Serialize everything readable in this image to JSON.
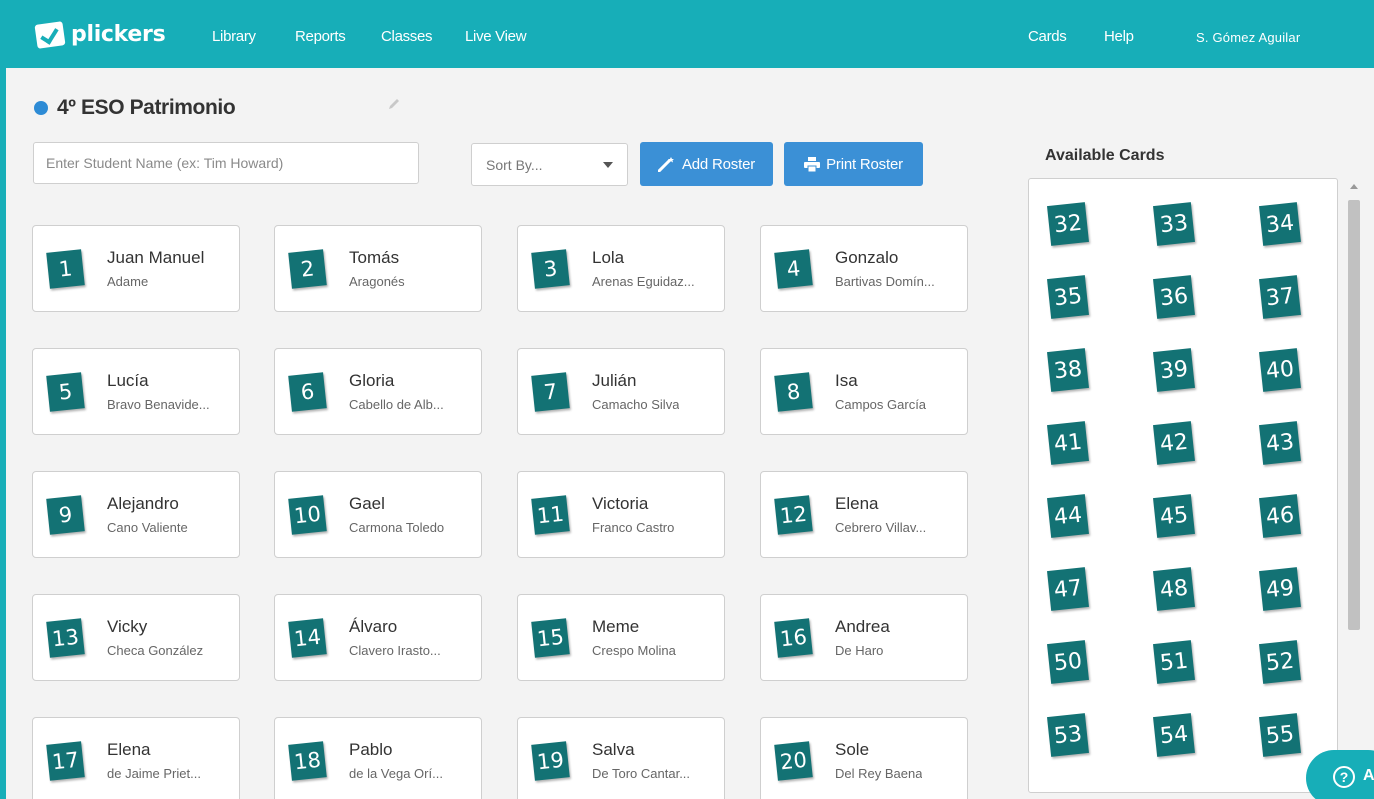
{
  "nav": {
    "logo_text": "plickers",
    "library": "Library",
    "reports": "Reports",
    "classes": "Classes",
    "live_view": "Live View",
    "cards": "Cards",
    "help": "Help",
    "user": "S. Gómez Aguilar"
  },
  "class": {
    "title": "4º ESO Patrimonio",
    "color": "#2d8bd5"
  },
  "toolbar": {
    "search_placeholder": "Enter Student Name (ex: Tim Howard)",
    "sort_label": "Sort By...",
    "add_roster": "Add Roster",
    "print_roster": "Print Roster"
  },
  "students": [
    {
      "num": "1",
      "first": "Juan Manuel",
      "last": "Adame"
    },
    {
      "num": "2",
      "first": "Tomás",
      "last": "Aragonés"
    },
    {
      "num": "3",
      "first": "Lola",
      "last": "Arenas Eguidaz..."
    },
    {
      "num": "4",
      "first": "Gonzalo",
      "last": "Bartivas Domín..."
    },
    {
      "num": "5",
      "first": "Lucía",
      "last": "Bravo Benavide..."
    },
    {
      "num": "6",
      "first": "Gloria",
      "last": "Cabello de Alb..."
    },
    {
      "num": "7",
      "first": "Julián",
      "last": "Camacho Silva"
    },
    {
      "num": "8",
      "first": "Isa",
      "last": "Campos García"
    },
    {
      "num": "9",
      "first": "Alejandro",
      "last": "Cano Valiente"
    },
    {
      "num": "10",
      "first": "Gael",
      "last": "Carmona Toledo"
    },
    {
      "num": "11",
      "first": "Victoria",
      "last": "Franco Castro"
    },
    {
      "num": "12",
      "first": "Elena",
      "last": "Cebrero Villav..."
    },
    {
      "num": "13",
      "first": "Vicky",
      "last": "Checa González"
    },
    {
      "num": "14",
      "first": "Álvaro",
      "last": "Clavero Irasto..."
    },
    {
      "num": "15",
      "first": "Meme",
      "last": "Crespo Molina"
    },
    {
      "num": "16",
      "first": "Andrea",
      "last": "De Haro"
    },
    {
      "num": "17",
      "first": "Elena",
      "last": "de Jaime Priet..."
    },
    {
      "num": "18",
      "first": "Pablo",
      "last": "de la Vega Orí..."
    },
    {
      "num": "19",
      "first": "Salva",
      "last": "De Toro Cantar..."
    },
    {
      "num": "20",
      "first": "Sole",
      "last": "Del Rey Baena"
    }
  ],
  "available_cards": {
    "title": "Available Cards",
    "numbers": [
      "32",
      "33",
      "34",
      "35",
      "36",
      "37",
      "38",
      "39",
      "40",
      "41",
      "42",
      "43",
      "44",
      "45",
      "46",
      "47",
      "48",
      "49",
      "50",
      "51",
      "52",
      "53",
      "54",
      "55"
    ]
  },
  "help_bubble": {
    "q": "?",
    "label": "A"
  },
  "colors": {
    "brand": "#17aeb8",
    "card": "#137274",
    "button": "#3b90d6"
  }
}
